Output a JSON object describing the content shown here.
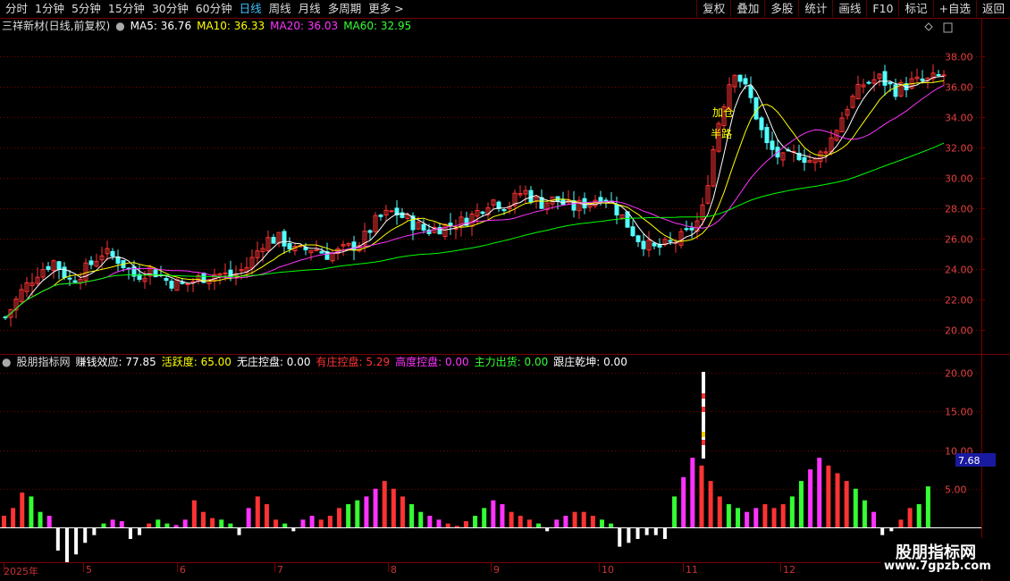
{
  "toolbar": {
    "periods": [
      "分时",
      "1分钟",
      "5分钟",
      "15分钟",
      "30分钟",
      "60分钟",
      "日线",
      "周线",
      "月线",
      "多周期",
      "更多"
    ],
    "active_period": "日线",
    "more_arrow": ">",
    "actions": [
      "复权",
      "叠加",
      "多股",
      "统计",
      "画线",
      "F10",
      "标记",
      "+自选",
      "返回"
    ]
  },
  "main_header": {
    "title": "三祥新材(日线,前复权)",
    "ma5": "MA5: 36.76",
    "ma10": "MA10: 36.33",
    "ma20": "MA20: 36.03",
    "ma60": "MA60: 32.95",
    "colors": {
      "ma5": "#ffffff",
      "ma10": "#ffff00",
      "ma20": "#ff33ff",
      "ma60": "#00ff00"
    }
  },
  "sub_header": {
    "title": "股朋指标网",
    "items": [
      {
        "text": "赚钱效应: 77.85",
        "color": "#ffffff"
      },
      {
        "text": "活跃度: 65.00",
        "color": "#ffff00"
      },
      {
        "text": "无庄控盘: 0.00",
        "color": "#ffffff"
      },
      {
        "text": "有庄控盘: 5.29",
        "color": "#ff3333"
      },
      {
        "text": "高度控盘: 0.00",
        "color": "#ff33ff"
      },
      {
        "text": "主力出货: 0.00",
        "color": "#33ff33"
      },
      {
        "text": "跟庄乾坤: 0.00",
        "color": "#ffffff"
      }
    ]
  },
  "annotations": {
    "add_position": "加仓",
    "half_way": "半路"
  },
  "main_axis": [
    "38.00",
    "36.00",
    "34.00",
    "32.00",
    "30.00",
    "28.00",
    "26.00",
    "24.00",
    "22.00",
    "20.00"
  ],
  "sub_axis": [
    "20.00",
    "15.00",
    "10.00",
    "5.00"
  ],
  "sub_axis_marker": "7.68",
  "x_axis": [
    "2025年",
    "5",
    "6",
    "7",
    "8",
    "9",
    "10",
    "11",
    "12"
  ],
  "watermark": {
    "line1": "股朋指标网",
    "line2": "www.7gpzb.com"
  },
  "colors": {
    "up": "#ff3333",
    "down": "#54ffff",
    "grid": "#7a0000",
    "axis_text": "#e04040"
  },
  "chart_data": [
    {
      "type": "candlestick",
      "title": "三祥新材(日线,前复权)",
      "ylim": [
        18.5,
        39.5
      ],
      "series": [
        {
          "name": "MA5",
          "values": [
            36.76
          ]
        },
        {
          "name": "MA10",
          "values": [
            36.33
          ]
        },
        {
          "name": "MA20",
          "values": [
            36.03
          ]
        },
        {
          "name": "MA60",
          "values": [
            32.95
          ]
        }
      ],
      "price_path": [
        20.8,
        22.5,
        23.8,
        24.5,
        23.2,
        24.0,
        25.1,
        24.6,
        23.5,
        24.0,
        23.2,
        22.9,
        23.4,
        23.7,
        23.5,
        24.2,
        25.9,
        26.0,
        25.1,
        25.4,
        24.9,
        25.3,
        25.8,
        27.3,
        27.8,
        27.1,
        26.5,
        26.8,
        27.0,
        27.6,
        28.6,
        28.1,
        29.2,
        28.3,
        28.6,
        28.0,
        28.4,
        28.9,
        27.6,
        26.1,
        25.3,
        25.6,
        26.2,
        27.4,
        33.4,
        37.3,
        35.4,
        32.2,
        31.2,
        31.6,
        31.0,
        32.5,
        34.7,
        36.2,
        36.6,
        35.8,
        36.3,
        36.4,
        36.8
      ]
    },
    {
      "type": "bar",
      "title": "股朋指标网",
      "ylim": [
        -5,
        20
      ],
      "bar_values": [
        1.5,
        2.5,
        4.5,
        4,
        2,
        1.5,
        -3,
        -4.5,
        -3.5,
        -2,
        -1,
        0.5,
        1,
        0.8,
        -1.5,
        -1,
        0.5,
        1,
        0.5,
        0.3,
        1,
        3.5,
        2,
        1.2,
        1,
        0.5,
        -1,
        2.5,
        4,
        3,
        1,
        0.5,
        -0.5,
        1,
        1.5,
        1,
        1.5,
        2.5,
        3,
        3.5,
        4,
        5,
        6,
        5,
        4,
        3,
        2,
        1.5,
        1,
        0.5,
        0.2,
        0.8,
        1.5,
        2.5,
        3.5,
        3,
        2,
        1.5,
        1,
        0.5,
        -0.5,
        1,
        1.5,
        2,
        2,
        1.5,
        1,
        0.5,
        -2.5,
        -2,
        -1.5,
        -1,
        -1,
        -1.5,
        4,
        6.5,
        9,
        8,
        6,
        4,
        3,
        2.5,
        2,
        2.5,
        3,
        2.5,
        3,
        4,
        6,
        7.5,
        9,
        8,
        7,
        6,
        5,
        3.5,
        2,
        -1,
        -0.5,
        1,
        2.5,
        3,
        5.3
      ]
    }
  ]
}
